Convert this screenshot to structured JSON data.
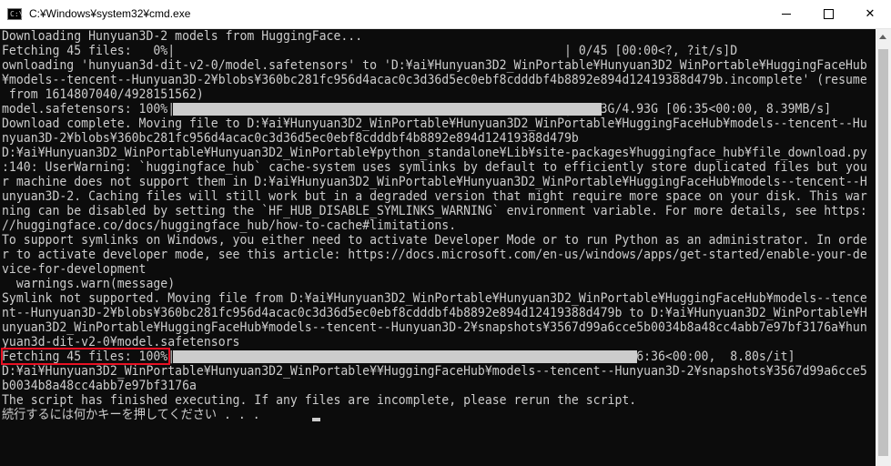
{
  "window": {
    "title": "C:¥Windows¥system32¥cmd.exe",
    "icon": "cmd-console-icon",
    "icon_glyph": "C:\\",
    "controls": [
      "minimize-icon",
      "maximize-icon",
      "close-icon"
    ],
    "close_glyph": "✕"
  },
  "console": {
    "lines": [
      "Downloading Hunyuan3D-2 models from HuggingFace...",
      "Fetching 45 files:   0%|                                                      | 0/45 [00:00<?, ?it/s]D",
      "ownloading 'hunyuan3d-dit-v2-0/model.safetensors' to 'D:¥ai¥Hunyuan3D2_WinPortable¥Hunyuan3D2_WinPortable¥HuggingFaceHub",
      "¥models--tencent--Hunyuan3D-2¥blobs¥360bc281fc956d4acac0c3d36d5ec0ebf8cdddbf4b8892e894d12419388d479b.incomplete' (resume",
      " from 1614807040/4928151562)",
      "model.safetensors: 100%|                                                      | 4.93G/4.93G [06:35<00:00, 8.39MB/s]",
      "Download complete. Moving file to D:¥ai¥Hunyuan3D2_WinPortable¥Hunyuan3D2_WinPortable¥HuggingFaceHub¥models--tencent--Hu",
      "nyuan3D-2¥blobs¥360bc281fc956d4acac0c3d36d5ec0ebf8cdddbf4b8892e894d12419388d479b",
      "D:¥ai¥Hunyuan3D2_WinPortable¥Hunyuan3D2_WinPortable¥python_standalone¥Lib¥site-packages¥huggingface_hub¥file_download.py",
      ":140: UserWarning: `huggingface_hub` cache-system uses symlinks by default to efficiently store duplicated files but you",
      "r machine does not support them in D:¥ai¥Hunyuan3D2_WinPortable¥Hunyuan3D2_WinPortable¥HuggingFaceHub¥models--tencent--H",
      "unyuan3D-2. Caching files will still work but in a degraded version that might require more space on your disk. This war",
      "ning can be disabled by setting the `HF_HUB_DISABLE_SYMLINKS_WARNING` environment variable. For more details, see https:",
      "//huggingface.co/docs/huggingface_hub/how-to-cache#limitations.",
      "To support symlinks on Windows, you either need to activate Developer Mode or to run Python as an administrator. In orde",
      "r to activate developer mode, see this article: https://docs.microsoft.com/en-us/windows/apps/get-started/enable-your-de",
      "vice-for-development",
      "  warnings.warn(message)",
      "Symlink not supported. Moving file from D:¥ai¥Hunyuan3D2_WinPortable¥Hunyuan3D2_WinPortable¥HuggingFaceHub¥models--tence",
      "nt--Hunyuan3D-2¥blobs¥360bc281fc956d4acac0c3d36d5ec0ebf8cdddbf4b8892e894d12419388d479b to D:¥ai¥Hunyuan3D2_WinPortable¥H",
      "unyuan3D2_WinPortable¥HuggingFaceHub¥models--tencent--Hunyuan3D-2¥snapshots¥3567d99a6cce5b0034b8a48cc4abb7e97bf3176a¥hun",
      "yuan3d-dit-v2-0¥model.safetensors",
      "Fetching 45 files: 100%|                                                      | 45/45 [06:36<00:00,  8.80s/it]",
      "D:¥ai¥Hunyuan3D2_WinPortable¥Hunyuan3D2_WinPortable¥¥HuggingFaceHub¥models--tencent--Hunyuan3D-2¥snapshots¥3567d99a6cce5",
      "b0034b8a48cc4abb7e97bf3176a",
      "The script has finished executing. If any files are incomplete, please rerun the script.",
      "続行するには何かキーを押してください . . ."
    ],
    "progress": [
      {
        "line": 1,
        "fraction": 0.0
      },
      {
        "line": 5,
        "fraction": 1.0
      },
      {
        "line": 22,
        "fraction": 1.0
      }
    ],
    "highlight_color": "#e81123",
    "text_color": "#cccccc",
    "background_color": "#0c0c0c"
  }
}
